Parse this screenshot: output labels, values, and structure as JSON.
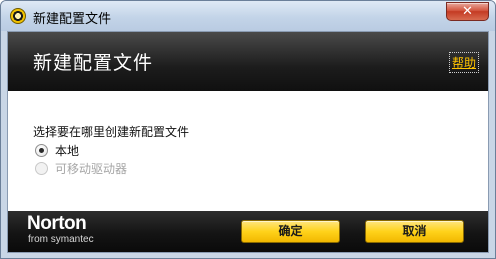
{
  "window": {
    "title": "新建配置文件",
    "close_glyph": "✕"
  },
  "header": {
    "title": "新建配置文件",
    "help_label": "帮助"
  },
  "content": {
    "prompt": "选择要在哪里创建新配置文件",
    "options": [
      {
        "label": "本地",
        "checked": true,
        "enabled": true
      },
      {
        "label": "可移动驱动器",
        "checked": false,
        "enabled": false
      }
    ]
  },
  "footer": {
    "brand_name": "Norton",
    "brand_sub": "from symantec",
    "ok_label": "确定",
    "cancel_label": "取消"
  },
  "colors": {
    "accent": "#ffd21a",
    "help_link": "#ffc400",
    "header_bg": "#1c1c1c"
  }
}
